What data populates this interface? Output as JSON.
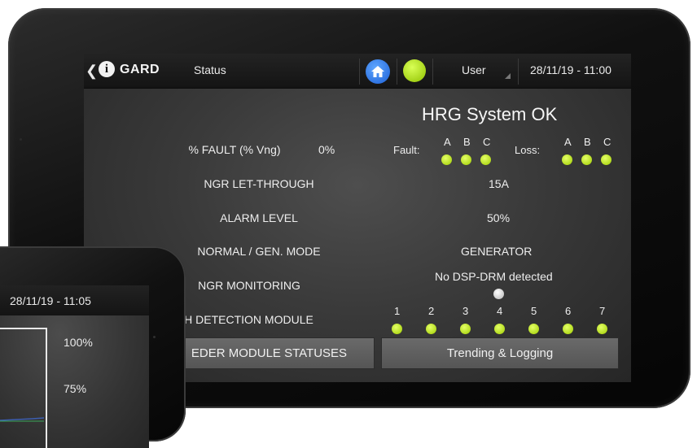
{
  "tablet": {
    "topbar": {
      "back_icon": "chevron-left-icon",
      "brand": "GARD",
      "page_title": "Status",
      "user_label": "User",
      "datetime": "28/11/19 - 11:00",
      "status_color": "#a8d400",
      "home_color": "#2d78f0"
    },
    "system_status": "HRG System OK",
    "rows": [
      {
        "label": "% FAULT (% Vng)",
        "value": "0%"
      },
      {
        "label": "NGR LET-THROUGH",
        "value": "15A"
      },
      {
        "label": "ALARM LEVEL",
        "value": "50%"
      },
      {
        "label": "NORMAL / GEN. MODE",
        "value": "GENERATOR"
      },
      {
        "label": "NGR MONITORING",
        "value": "No DSP-DRM detected"
      },
      {
        "label": "FLASH DETECTION MODULE",
        "value": ""
      }
    ],
    "fault": {
      "label": "Fault:",
      "phases": [
        "A",
        "B",
        "C"
      ]
    },
    "loss": {
      "label": "Loss:",
      "phases": [
        "A",
        "B",
        "C"
      ]
    },
    "flash_modules": [
      "1",
      "2",
      "3",
      "4",
      "5",
      "6",
      "7"
    ],
    "buttons": {
      "feeder": "EDER MODULE STATUSES",
      "trending": "Trending & Logging"
    }
  },
  "phone": {
    "datetime": "28/11/19 - 11:05",
    "pct_100": "100%",
    "pct_75": "75%"
  }
}
